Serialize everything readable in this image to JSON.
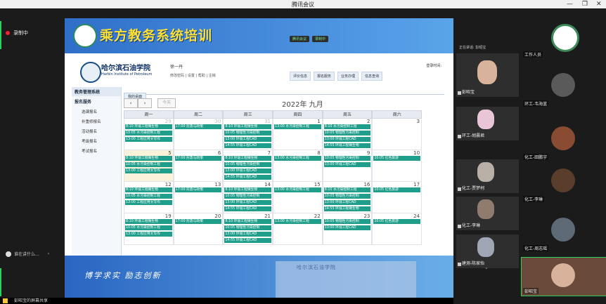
{
  "window": {
    "title": "腾讯会议",
    "minimize": "—",
    "maximize": "❐",
    "close": "✕"
  },
  "left": {
    "recording_label": "录制中",
    "speaking_label": "谁在讲什么..."
  },
  "share_toolbar": [
    "腾讯会议",
    "录制中"
  ],
  "banner": {
    "title": "乘方教务系统培训"
  },
  "sys": {
    "school_name": "哈尔滨石油学院",
    "school_en": "Harbin Institute of Petroleum",
    "user": "徐一丹",
    "links": "修改密码 | 设置 | 帮助 | 注销",
    "login_time": "登录时间:",
    "menus": [
      "评价信息",
      "报名服务",
      "业务办理",
      "信息查询"
    ],
    "sidebar_header": "教务管理系统",
    "sidebar_sub": "报名服务",
    "sidebar_items": [
      "选课报名",
      "补重修报名",
      "活动报名",
      "考级报名",
      "考试报名"
    ],
    "tab": "我的桌面",
    "today_button": "今天",
    "month_title": "2022年 九月",
    "dow": [
      "周一",
      "周二",
      "周三",
      "周四",
      "周五",
      "周六"
    ],
    "weeks": [
      {
        "days": [
          {
            "d": "29",
            "dim": true,
            "ev": [
              "8:10 环境工程微生物",
              "10:05 水污染控制工程",
              "13:00 工程应用文写作"
            ]
          },
          {
            "d": "30",
            "dim": true,
            "ev": [
              "17:00 形势与政策"
            ]
          },
          {
            "d": "31",
            "dim": true,
            "ev": [
              "8:10 环境工程微生物",
              "10:05 物理性污染控制",
              "13:00 环境工程CAD",
              "14:55 环境工程CAD"
            ]
          },
          {
            "d": "1",
            "dim": false,
            "ev": [
              "13:00 水污染控制工程"
            ]
          },
          {
            "d": "2",
            "dim": false,
            "ev": [
              "8:10 水污染控制工程",
              "10:05 物理性污染控制",
              "13:00 环境工程CAD",
              "14:55 环境工程微生物"
            ]
          },
          {
            "d": "3",
            "dim": false,
            "ev": []
          }
        ]
      },
      {
        "days": [
          {
            "d": "5",
            "dim": false,
            "today": true,
            "ev": [
              "8:10 环境工程微生物",
              "10:05 水污染控制工程",
              "13:00 工程应用文写作"
            ]
          },
          {
            "d": "6",
            "dim": false,
            "ev": [
              "17:00 形势与政策"
            ]
          },
          {
            "d": "7",
            "dim": false,
            "ev": [
              "8:10 环境工程微生物",
              "10:05 物理性污染控制",
              "13:00 环境工程CAD",
              "14:55 环境工程CAD"
            ]
          },
          {
            "d": "8",
            "dim": false,
            "ev": [
              "13:00 水污染控制工程"
            ]
          },
          {
            "d": "9",
            "dim": false,
            "ev": [
              "10:05 物理性污染控制",
              "13:00 环境工程CAD"
            ]
          },
          {
            "d": "10",
            "dim": false,
            "ev": [
              "10:05 红色旅游"
            ]
          }
        ]
      },
      {
        "days": [
          {
            "d": "12",
            "dim": false,
            "ev": [
              "8:10 环境工程微生物",
              "10:05 水污染控制工程",
              "13:00 工程应用文写作"
            ]
          },
          {
            "d": "13",
            "dim": false,
            "ev": [
              "17:00 形势与政策"
            ]
          },
          {
            "d": "14",
            "dim": false,
            "ev": [
              "8:10 环境工程微生物",
              "10:05 物理性污染控制",
              "13:00 环境工程CAD",
              "14:55 环境工程CAD"
            ]
          },
          {
            "d": "15",
            "dim": false,
            "ev": [
              "13:00 水污染控制工程"
            ]
          },
          {
            "d": "16",
            "dim": false,
            "ev": [
              "8:10 水污染控制工程",
              "10:05 物理性污染控制",
              "13:00 环境工程CAD",
              "14:55 环境工程微生物"
            ]
          },
          {
            "d": "17",
            "dim": false,
            "ev": [
              "10:05 红色旅游"
            ]
          }
        ]
      },
      {
        "days": [
          {
            "d": "19",
            "dim": false,
            "ev": [
              "8:10 环境工程微生物",
              "10:05 水污染控制工程",
              "13:00 工程应用文写作"
            ]
          },
          {
            "d": "20",
            "dim": false,
            "ev": [
              "17:00 形势与政策"
            ]
          },
          {
            "d": "21",
            "dim": false,
            "ev": [
              "8:10 环境工程微生物",
              "10:05 物理性污染控制",
              "13:00 环境工程CAD",
              "14:55 环境工程CAD"
            ]
          },
          {
            "d": "22",
            "dim": false,
            "ev": [
              "13:00 水污染控制工程"
            ]
          },
          {
            "d": "23",
            "dim": false,
            "ev": [
              "10:05 物理性污染控制",
              "13:00 环境工程CAD"
            ]
          },
          {
            "d": "24",
            "dim": false,
            "ev": [
              "10:05 红色旅游"
            ]
          }
        ]
      }
    ]
  },
  "footer": {
    "motto": "博学求实  励志创新",
    "building_text": "哈尔滨石油学院"
  },
  "bottombar": {
    "text": "彭昭宝的屏幕共享"
  },
  "videos": {
    "speaking_now": "正在讲话: 彭昭宝",
    "thumbs": [
      "彭昭宝",
      "环工-胡晨君",
      "化工-贾梦柯",
      "化工-李琳",
      "建测-陈家怡"
    ]
  },
  "right": {
    "thumbs": [
      "工作人员",
      "环工-韦海蓝",
      "化工-田鹏宇",
      "化工-李琳",
      "化工-周志瑶",
      "彭昭宝"
    ]
  },
  "colors": {
    "event": "#1e9e8b",
    "banner": "#2f6fc9",
    "title_yellow": "#ffe033",
    "rec_green": "#2cd15b"
  }
}
